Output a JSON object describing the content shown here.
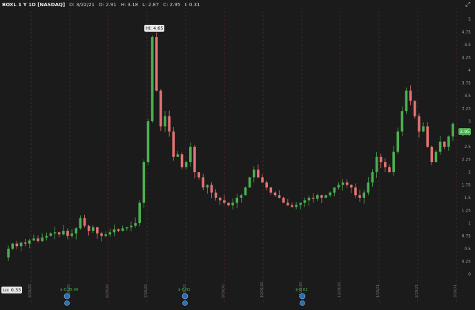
{
  "header": {
    "symbol": "BOXL 1 Y 1D [NASDAQ]",
    "date": "D: 3/22/21",
    "open": "O: 2.91",
    "high": "H: 3.18",
    "low": "L: 2.87",
    "close": "C: 2.95",
    "change": "I: 0.31"
  },
  "labels": {
    "hi": "Hi: 4.65",
    "lo": "Lo: 0.33",
    "last": "2.95"
  },
  "events": [
    {
      "label": "$-0.05",
      "extra": ".06"
    },
    {
      "label": "$-0.01",
      "extra": ""
    },
    {
      "label": "$-0.02",
      "extra": ""
    }
  ],
  "colors": {
    "up": "#4caf50",
    "down": "#e57373",
    "grid": "#5a2a2a",
    "bg": "#1b1b1b"
  },
  "chart_data": {
    "type": "candlestick",
    "ylim": [
      0,
      5
    ],
    "yticks": [
      "0",
      "0.25",
      "0.5",
      "0.75",
      "1",
      "1.25",
      "1.5",
      "1.75",
      "2",
      "2.25",
      "2.5",
      "2.75",
      "3",
      "3.25",
      "3.5",
      "3.75",
      "4",
      "4.25",
      "4.5",
      "4.75",
      "5"
    ],
    "xticks": [
      "4/20/20",
      "5/20/20",
      "6/20/20",
      "7/20/20",
      "8/20/20",
      "9/20/20",
      "10/20/20",
      "11/20/20",
      "12/20/20",
      "1/20/21",
      "2/20/21",
      "3/20/21"
    ],
    "close_path": [
      0.33,
      0.5,
      0.6,
      0.55,
      0.62,
      0.6,
      0.66,
      0.7,
      0.65,
      0.72,
      0.75,
      0.8,
      0.82,
      0.78,
      0.85,
      0.75,
      0.8,
      0.9,
      1.1,
      0.95,
      0.85,
      0.92,
      0.8,
      0.75,
      0.78,
      0.82,
      0.88,
      0.85,
      0.9,
      0.92,
      0.95,
      1.0,
      1.4,
      2.2,
      3.0,
      4.65,
      3.6,
      2.9,
      3.1,
      2.8,
      2.3,
      2.35,
      2.1,
      2.2,
      2.5,
      2.0,
      1.9,
      1.7,
      1.75,
      1.6,
      1.5,
      1.45,
      1.4,
      1.35,
      1.4,
      1.5,
      1.55,
      1.7,
      1.9,
      2.05,
      1.9,
      1.8,
      1.7,
      1.6,
      1.55,
      1.5,
      1.4,
      1.35,
      1.32,
      1.36,
      1.4,
      1.45,
      1.5,
      1.48,
      1.55,
      1.5,
      1.55,
      1.6,
      1.7,
      1.75,
      1.8,
      1.75,
      1.7,
      1.55,
      1.5,
      1.6,
      1.8,
      2.0,
      2.3,
      2.2,
      2.1,
      2.0,
      2.4,
      2.8,
      3.2,
      3.6,
      3.4,
      3.1,
      2.8,
      2.9,
      2.5,
      2.2,
      2.4,
      2.6,
      2.5,
      2.7,
      2.95
    ]
  }
}
